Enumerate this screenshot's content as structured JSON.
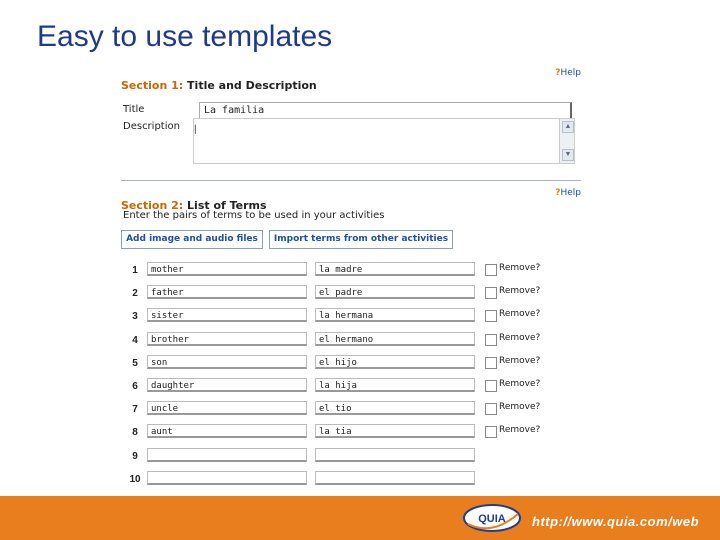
{
  "slide": {
    "title": "Easy to use templates"
  },
  "section1": {
    "number_label": "Section 1:",
    "name": "Title and Description",
    "help": "Help",
    "title_label": "Title",
    "title_value": "La familia",
    "description_label": "Description",
    "description_value": "|"
  },
  "section2": {
    "number_label": "Section 2:",
    "name": "List of Terms",
    "help": "Help",
    "intro": "Enter the pairs of terms to be used in your activities",
    "add_button": "Add image and audio files",
    "import_button": "Import terms from other activities",
    "rows": [
      {
        "num": "1",
        "term": "mother",
        "def": "la madre",
        "remove": "Remove?"
      },
      {
        "num": "2",
        "term": "father",
        "def": "el padre",
        "remove": "Remove?"
      },
      {
        "num": "3",
        "term": "sister",
        "def": "la hermana",
        "remove": "Remove?"
      },
      {
        "num": "4",
        "term": "brother",
        "def": "el hermano",
        "remove": "Remove?"
      },
      {
        "num": "5",
        "term": "son",
        "def": "el hijo",
        "remove": "Remove?"
      },
      {
        "num": "6",
        "term": "daughter",
        "def": "la hija",
        "remove": "Remove?"
      },
      {
        "num": "7",
        "term": "uncle",
        "def": "el tio",
        "remove": "Remove?"
      },
      {
        "num": "8",
        "term": "aunt",
        "def": "la tia",
        "remove": "Remove?"
      },
      {
        "num": "9",
        "term": "",
        "def": "",
        "remove": ""
      },
      {
        "num": "10",
        "term": "",
        "def": "",
        "remove": ""
      }
    ]
  },
  "footer": {
    "logo_text": "QUIA",
    "url": "http://www.quia.com/web",
    "color": "#e87e1d"
  }
}
